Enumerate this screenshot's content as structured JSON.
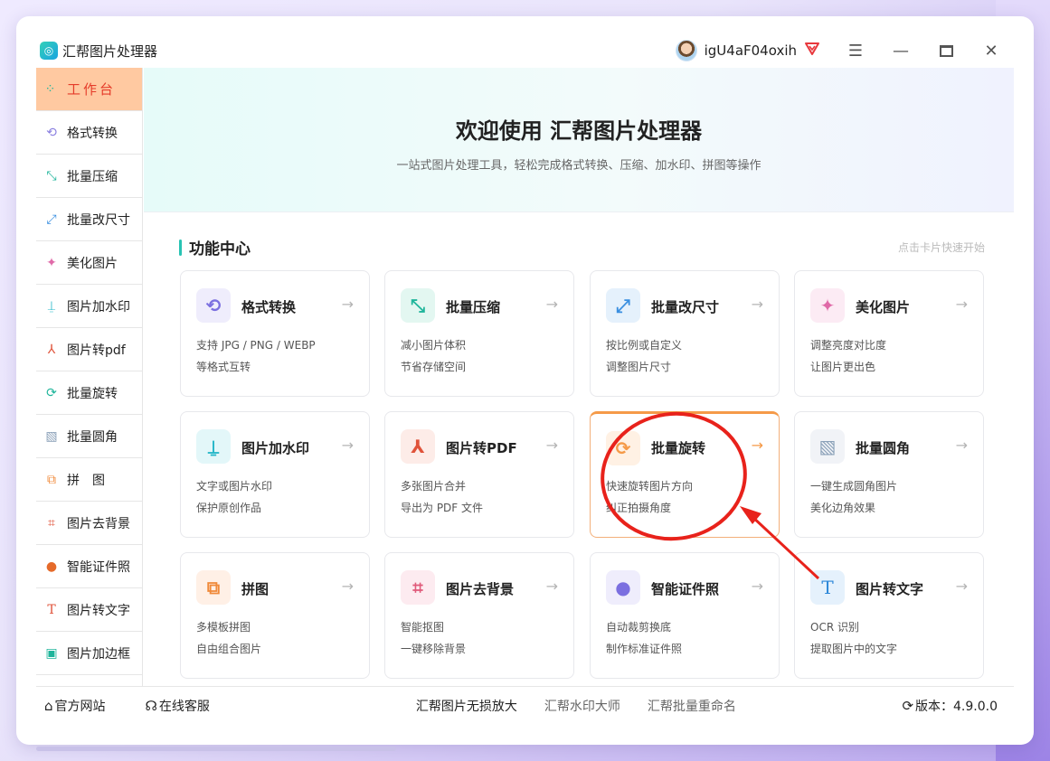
{
  "app": {
    "title": "汇帮图片处理器",
    "username": "igU4aF04oxih"
  },
  "colors": {
    "accent": "#28c3b3",
    "active_bg": "#ffc9a1",
    "active_text": "#e53c2a",
    "highlight_border": "#f59a48",
    "annotation": "#e8221b"
  },
  "sidebar": {
    "items": [
      {
        "label": "工作台",
        "icon": "grid-icon"
      },
      {
        "label": "格式转换",
        "icon": "convert-icon"
      },
      {
        "label": "批量压缩",
        "icon": "compress-icon"
      },
      {
        "label": "批量改尺寸",
        "icon": "resize-icon"
      },
      {
        "label": "美化图片",
        "icon": "beautify-icon"
      },
      {
        "label": "图片加水印",
        "icon": "watermark-icon"
      },
      {
        "label": "图片转pdf",
        "icon": "pdf-icon"
      },
      {
        "label": "批量旋转",
        "icon": "rotate-icon"
      },
      {
        "label": "批量圆角",
        "icon": "rounded-corner-icon"
      },
      {
        "label": "拼　图",
        "icon": "puzzle-icon"
      },
      {
        "label": "图片去背景",
        "icon": "crop-icon"
      },
      {
        "label": "智能证件照",
        "icon": "person-icon"
      },
      {
        "label": "图片转文字",
        "icon": "text-icon"
      },
      {
        "label": "图片加边框",
        "icon": "frame-icon"
      }
    ]
  },
  "hero": {
    "title": "欢迎使用 汇帮图片处理器",
    "subtitle": "一站式图片处理工具，轻松完成格式转换、压缩、加水印、拼图等操作"
  },
  "section": {
    "title": "功能中心",
    "hint": "点击卡片快速开始"
  },
  "cards": [
    {
      "title": "格式转换",
      "line1": "支持 JPG / PNG / WEBP",
      "line2": "等格式互转",
      "icon": "convert-icon"
    },
    {
      "title": "批量压缩",
      "line1": "减小图片体积",
      "line2": "节省存储空间",
      "icon": "compress-icon"
    },
    {
      "title": "批量改尺寸",
      "line1": "按比例或自定义",
      "line2": "调整图片尺寸",
      "icon": "resize-icon"
    },
    {
      "title": "美化图片",
      "line1": "调整亮度对比度",
      "line2": "让图片更出色",
      "icon": "beautify-icon"
    },
    {
      "title": "图片加水印",
      "line1": "文字或图片水印",
      "line2": "保护原创作品",
      "icon": "watermark-icon"
    },
    {
      "title": "图片转PDF",
      "line1": "多张图片合并",
      "line2": "导出为 PDF 文件",
      "icon": "pdf-icon"
    },
    {
      "title": "批量旋转",
      "line1": "快速旋转图片方向",
      "line2": "纠正拍摄角度",
      "icon": "rotate-icon"
    },
    {
      "title": "批量圆角",
      "line1": "一键生成圆角图片",
      "line2": "美化边角效果",
      "icon": "rounded-corner-icon"
    },
    {
      "title": "拼图",
      "line1": "多模板拼图",
      "line2": "自由组合图片",
      "icon": "puzzle-icon"
    },
    {
      "title": "图片去背景",
      "line1": "智能抠图",
      "line2": "一键移除背景",
      "icon": "crop-icon"
    },
    {
      "title": "智能证件照",
      "line1": "自动裁剪换底",
      "line2": "制作标准证件照",
      "icon": "person-icon"
    },
    {
      "title": "图片转文字",
      "line1": "OCR 识别",
      "line2": "提取图片中的文字",
      "icon": "text-icon"
    }
  ],
  "footer": {
    "home": "官方网站",
    "service": "在线客服",
    "link1": "汇帮图片无损放大",
    "link2": "汇帮水印大师",
    "link3": "汇帮批量重命名",
    "version": "版本：4.9.0.0"
  }
}
